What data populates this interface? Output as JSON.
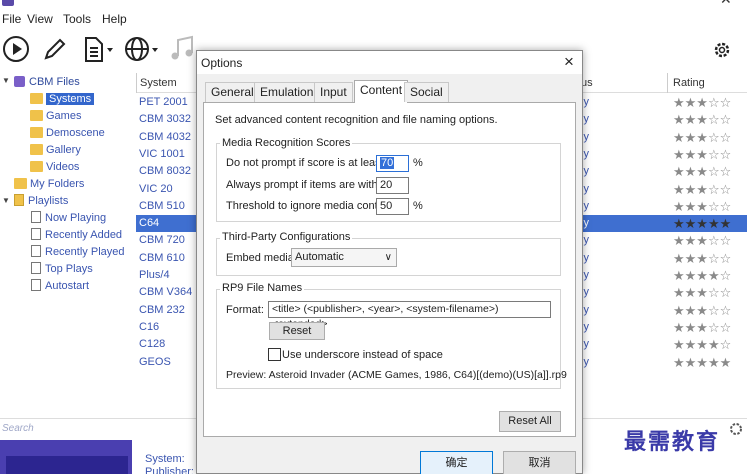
{
  "menu": [
    "File",
    "View",
    "Tools",
    "Help"
  ],
  "tree": {
    "root": "CBM Files",
    "children": [
      "Systems",
      "Games",
      "Demoscene",
      "Gallery",
      "Videos"
    ],
    "my_folders": "My Folders",
    "playlists": "Playlists",
    "playlist_items": [
      "Now Playing",
      "Recently Added",
      "Recently Played",
      "Top Plays",
      "Autostart"
    ]
  },
  "list": {
    "col_system": "System",
    "col_status": "us",
    "col_rating": "Rating",
    "rows": [
      {
        "system": "PET 2001",
        "status": "ly",
        "rating": "★★★☆☆"
      },
      {
        "system": "CBM 3032",
        "status": "ly",
        "rating": "★★★☆☆"
      },
      {
        "system": "CBM 4032",
        "status": "ly",
        "rating": "★★★☆☆"
      },
      {
        "system": "VIC 1001",
        "status": "ly",
        "rating": "★★★☆☆"
      },
      {
        "system": "CBM 8032",
        "status": "ly",
        "rating": "★★★☆☆"
      },
      {
        "system": "VIC 20",
        "status": "ly",
        "rating": "★★★☆☆"
      },
      {
        "system": "CBM 510",
        "status": "ly",
        "rating": "★★★☆☆"
      },
      {
        "system": "C64",
        "status": "ly",
        "rating": "★★★★★",
        "selected": true
      },
      {
        "system": "CBM 720",
        "status": "ly",
        "rating": "★★★☆☆"
      },
      {
        "system": "CBM 610",
        "status": "ly",
        "rating": "★★★☆☆"
      },
      {
        "system": "Plus/4",
        "status": "ly",
        "rating": "★★★★☆"
      },
      {
        "system": "CBM V364",
        "status": "ly",
        "rating": "★★★☆☆"
      },
      {
        "system": "CBM 232",
        "status": "ly",
        "rating": "★★★☆☆"
      },
      {
        "system": "C16",
        "status": "ly",
        "rating": "★★★☆☆"
      },
      {
        "system": "C128",
        "status": "ly",
        "rating": "★★★★☆"
      },
      {
        "system": "GEOS",
        "status": "ly",
        "rating": "★★★★★"
      }
    ]
  },
  "search_placeholder": "Search",
  "bottom": {
    "system_label": "System:",
    "publisher_label": "Publisher:"
  },
  "watermark": "最需教育",
  "dialog": {
    "title": "Options",
    "tabs": [
      "General",
      "Emulation",
      "Input",
      "Content",
      "Social"
    ],
    "active_tab": "Content",
    "description": "Set advanced content recognition and file naming options.",
    "media": {
      "title": "Media Recognition Scores",
      "row1_label": "Do not prompt if score is at least:",
      "row1_value": "70",
      "row2_label": "Always prompt if items are within:",
      "row2_value": "20",
      "row3_label": "Threshold to ignore media content:",
      "row3_value": "50",
      "percent": "%"
    },
    "third_party": {
      "title": "Third-Party Configurations",
      "embed_label": "Embed media:",
      "embed_value": "Automatic"
    },
    "rp9": {
      "title": "RP9 File Names",
      "format_label": "Format:",
      "format_value": "<title> (<publisher>, <year>, <system-filename>)<extended>",
      "reset": "Reset",
      "underscore": "Use underscore instead of space",
      "preview": "Preview:  Asteroid Invader (ACME Games, 1986, C64)[(demo)(US)[a]].rp9"
    },
    "reset_all": "Reset All",
    "ok": "确定",
    "cancel": "取消"
  }
}
